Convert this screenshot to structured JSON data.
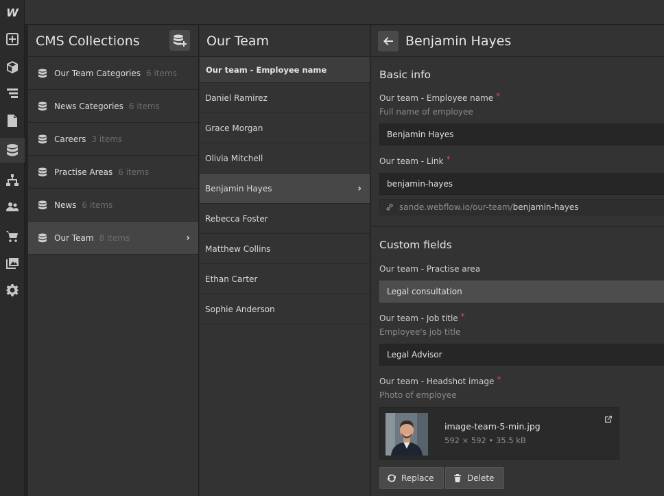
{
  "app": {
    "logo": "W"
  },
  "rail": {
    "icons": [
      "add-icon",
      "cube-icon",
      "navigator-icon",
      "pages-icon",
      "cms-database-icon",
      "logic-icon",
      "users-icon",
      "ecommerce-cart-icon",
      "assets-icon",
      "settings-gear-icon"
    ]
  },
  "collections": {
    "title": "CMS Collections",
    "items": [
      {
        "name": "Our Team Categories",
        "count": "6 items"
      },
      {
        "name": "News Categories",
        "count": "6 items"
      },
      {
        "name": "Careers",
        "count": "3 items"
      },
      {
        "name": "Practise Areas",
        "count": "6 items"
      },
      {
        "name": "News",
        "count": "6 items"
      },
      {
        "name": "Our Team",
        "count": "8 items"
      }
    ]
  },
  "team_list": {
    "title": "Our Team",
    "column_header": "Our team - Employee name",
    "items": [
      "Daniel Ramirez",
      "Grace Morgan",
      "Olivia Mitchell",
      "Benjamin Hayes",
      "Rebecca Foster",
      "Matthew Collins",
      "Ethan Carter",
      "Sophie Anderson"
    ]
  },
  "editor": {
    "title": "Benjamin Hayes",
    "basic_info": {
      "title": "Basic info",
      "name_label": "Our team - Employee name",
      "name_help": "Full name of employee",
      "name_value": "Benjamin Hayes",
      "link_label": "Our team - Link",
      "link_value": "benjamin-hayes",
      "url_prefix": "sande.webflow.io/our-team/",
      "url_slug": "benjamin-hayes"
    },
    "custom_fields": {
      "title": "Custom fields",
      "practise_label": "Our team - Practise area",
      "practise_value": "Legal consultation",
      "job_label": "Our team - Job title",
      "job_help": "Employee's job title",
      "job_value": "Legal Advisor",
      "headshot_label": "Our team - Headshot image",
      "headshot_help": "Photo of employee",
      "image_name": "image-team-5-min.jpg",
      "image_meta": "592 × 592 • 35.5 kB",
      "replace_label": "Replace",
      "delete_label": "Delete"
    },
    "required_mark": "*"
  }
}
